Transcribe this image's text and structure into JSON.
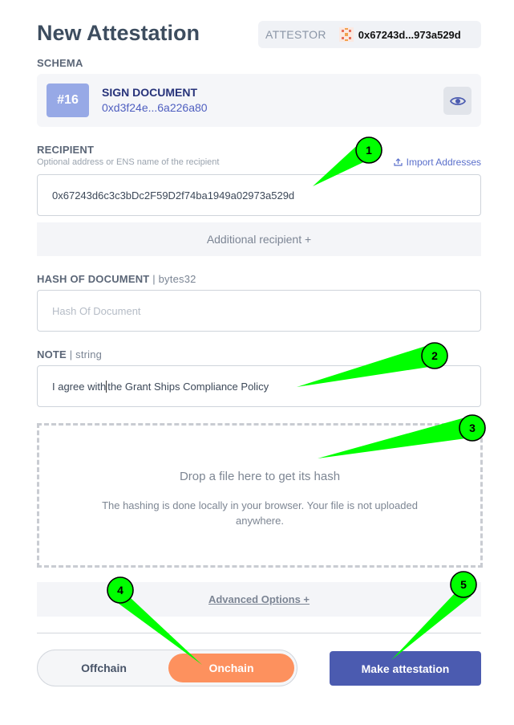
{
  "header": {
    "title": "New Attestation",
    "attestor_label": "ATTESTOR",
    "attestor_address": "0x67243d...973a529d"
  },
  "schema": {
    "section_label": "SCHEMA",
    "number": "#16",
    "name": "SIGN DOCUMENT",
    "uid": "0xd3f24e...6a226a80"
  },
  "recipient": {
    "label": "RECIPIENT",
    "help": "Optional address or ENS name of the recipient",
    "import_label": "Import Addresses",
    "value": "0x67243d6c3c3bDc2F59D2f74ba1949a02973a529d",
    "add_label": "Additional recipient +"
  },
  "hash_field": {
    "label": "HASH OF DOCUMENT",
    "type": "| bytes32",
    "placeholder": "Hash Of Document"
  },
  "note_field": {
    "label": "NOTE",
    "type": "| string",
    "value_before": "I agree with",
    "value_after": "the Grant Ships Compliance Policy"
  },
  "dropzone": {
    "title": "Drop a file here to get its hash",
    "subtitle": "The hashing is done locally in your browser. Your file is not uploaded anywhere."
  },
  "advanced": {
    "label": "Advanced Options +"
  },
  "mode_toggle": {
    "offchain": "Offchain",
    "onchain": "Onchain",
    "selected": "Onchain"
  },
  "submit": {
    "label": "Make attestation"
  },
  "annotations": [
    "1",
    "2",
    "3",
    "4",
    "5"
  ],
  "colors": {
    "accent": "#4b5bb0",
    "onchain": "#fd915e",
    "marker": "#00ff00",
    "schema_badge": "#97a9e6"
  }
}
